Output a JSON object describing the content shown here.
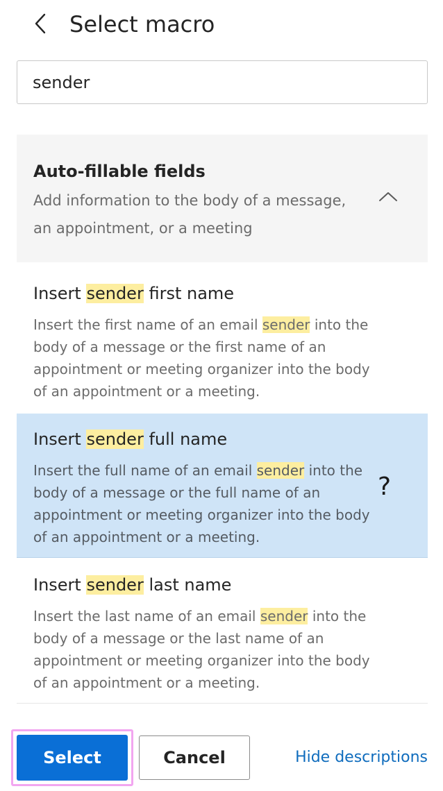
{
  "header": {
    "title": "Select macro",
    "back_icon": "chevron-left-icon"
  },
  "search": {
    "value": "sender"
  },
  "group": {
    "title": "Auto-fillable fields",
    "description": "Add information to the body of a message, an appointment, or a meeting",
    "toggle_icon": "chevron-up-icon",
    "expanded": true
  },
  "items": [
    {
      "title_pre": "Insert ",
      "title_match": "sender",
      "title_post": " first name",
      "desc_pre": "Insert the first name of an email ",
      "desc_match": "sender",
      "desc_post": " into the body of a message or the first name of an appointment or meeting organizer into the body of an appointment or a meeting.",
      "selected": false
    },
    {
      "title_pre": "Insert ",
      "title_match": "sender",
      "title_post": " full name",
      "desc_pre": "Insert the full name of an email ",
      "desc_match": "sender",
      "desc_post": " into the body of a message or the full name of an appointment or meeting organizer into the body of an appointment or a meeting.",
      "selected": true
    },
    {
      "title_pre": "Insert ",
      "title_match": "sender",
      "title_post": " last name",
      "desc_pre": "Insert the last name of an email ",
      "desc_match": "sender",
      "desc_post": " into the body of a message or the last name of an appointment or meeting organizer into the body of an appointment or a meeting.",
      "selected": false
    }
  ],
  "cursor": {
    "glyph": "?",
    "icon": "help-cursor-icon"
  },
  "footer": {
    "select_label": "Select",
    "cancel_label": "Cancel",
    "hide_descriptions_label": "Hide descriptions"
  },
  "colors": {
    "accent": "#0a6fd6",
    "selected_bg": "#cfe4f7",
    "highlight": "#fdeea0",
    "focus_ring": "#f2a6f0",
    "link": "#0f6cbd"
  }
}
